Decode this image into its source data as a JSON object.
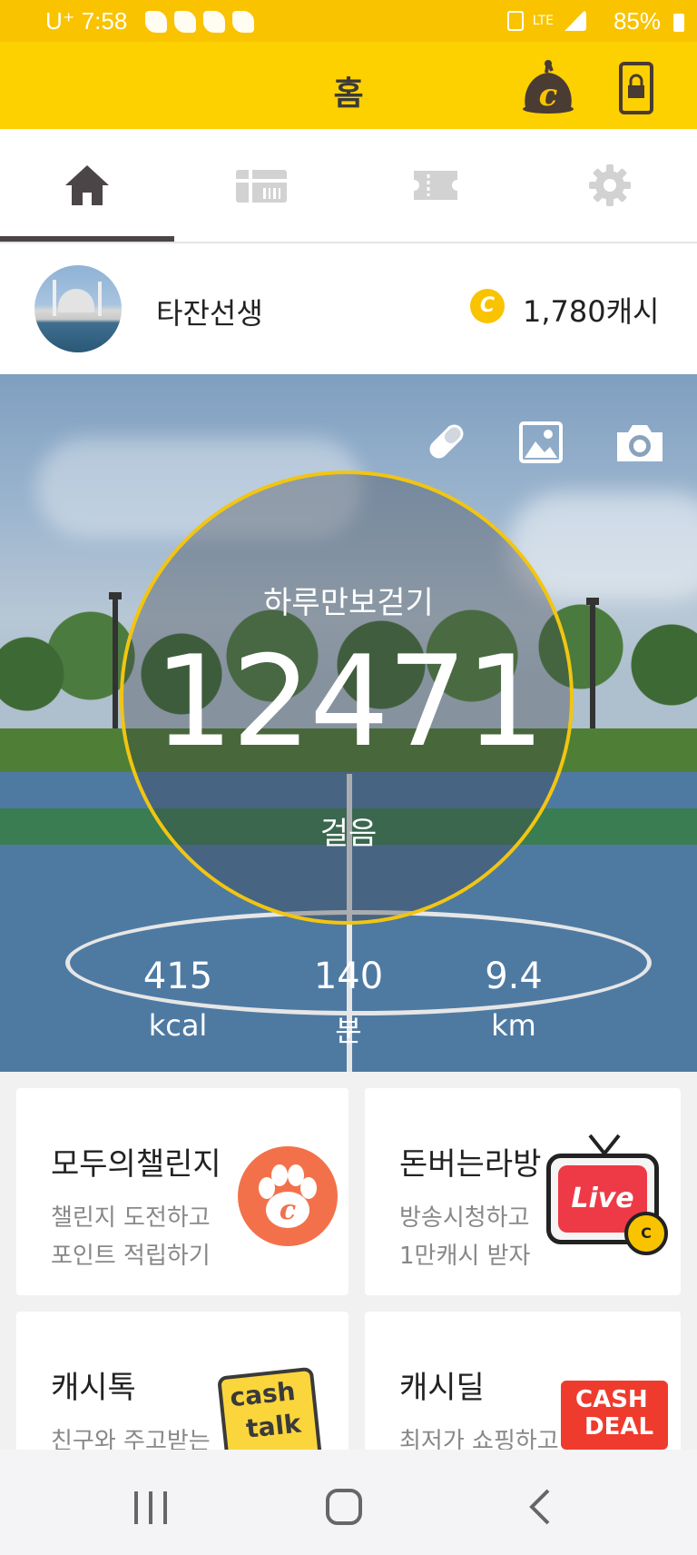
{
  "status_bar": {
    "carrier_time": "U⁺ 7:58",
    "battery": "85%",
    "network": "LTE"
  },
  "header": {
    "title": "홈"
  },
  "tabs": [
    {
      "name": "home"
    },
    {
      "name": "cash-ticket"
    },
    {
      "name": "coupon"
    },
    {
      "name": "settings"
    }
  ],
  "profile": {
    "username": "타잔선생",
    "cash": "1,780캐시",
    "cash_icon": "C"
  },
  "walk": {
    "goal_label": "하루만보걷기",
    "steps": "12471",
    "steps_unit": "걸음",
    "stats": [
      {
        "value": "415",
        "unit": "kcal"
      },
      {
        "value": "140",
        "unit": "분"
      },
      {
        "value": "9.4",
        "unit": "km"
      }
    ]
  },
  "cards": [
    {
      "title": "모두의챌린지",
      "subtitle": "챌린지 도전하고\n포인트 적립하기"
    },
    {
      "title": "돈버는라방",
      "subtitle": "방송시청하고\n1만캐시 받자",
      "badge": "Live",
      "coin": "C"
    },
    {
      "title": "캐시톡",
      "subtitle": "친구와 주고받는",
      "logo_l1": "cash",
      "logo_l2": "talk"
    },
    {
      "title": "캐시딜",
      "subtitle": "최저가 쇼핑하고",
      "logo_l1": "CASH",
      "logo_l2": "DEAL"
    }
  ],
  "colors": {
    "accent": "#fdd000",
    "ring": "#f2c511",
    "paw": "#f3714a",
    "live": "#ee3a46"
  }
}
